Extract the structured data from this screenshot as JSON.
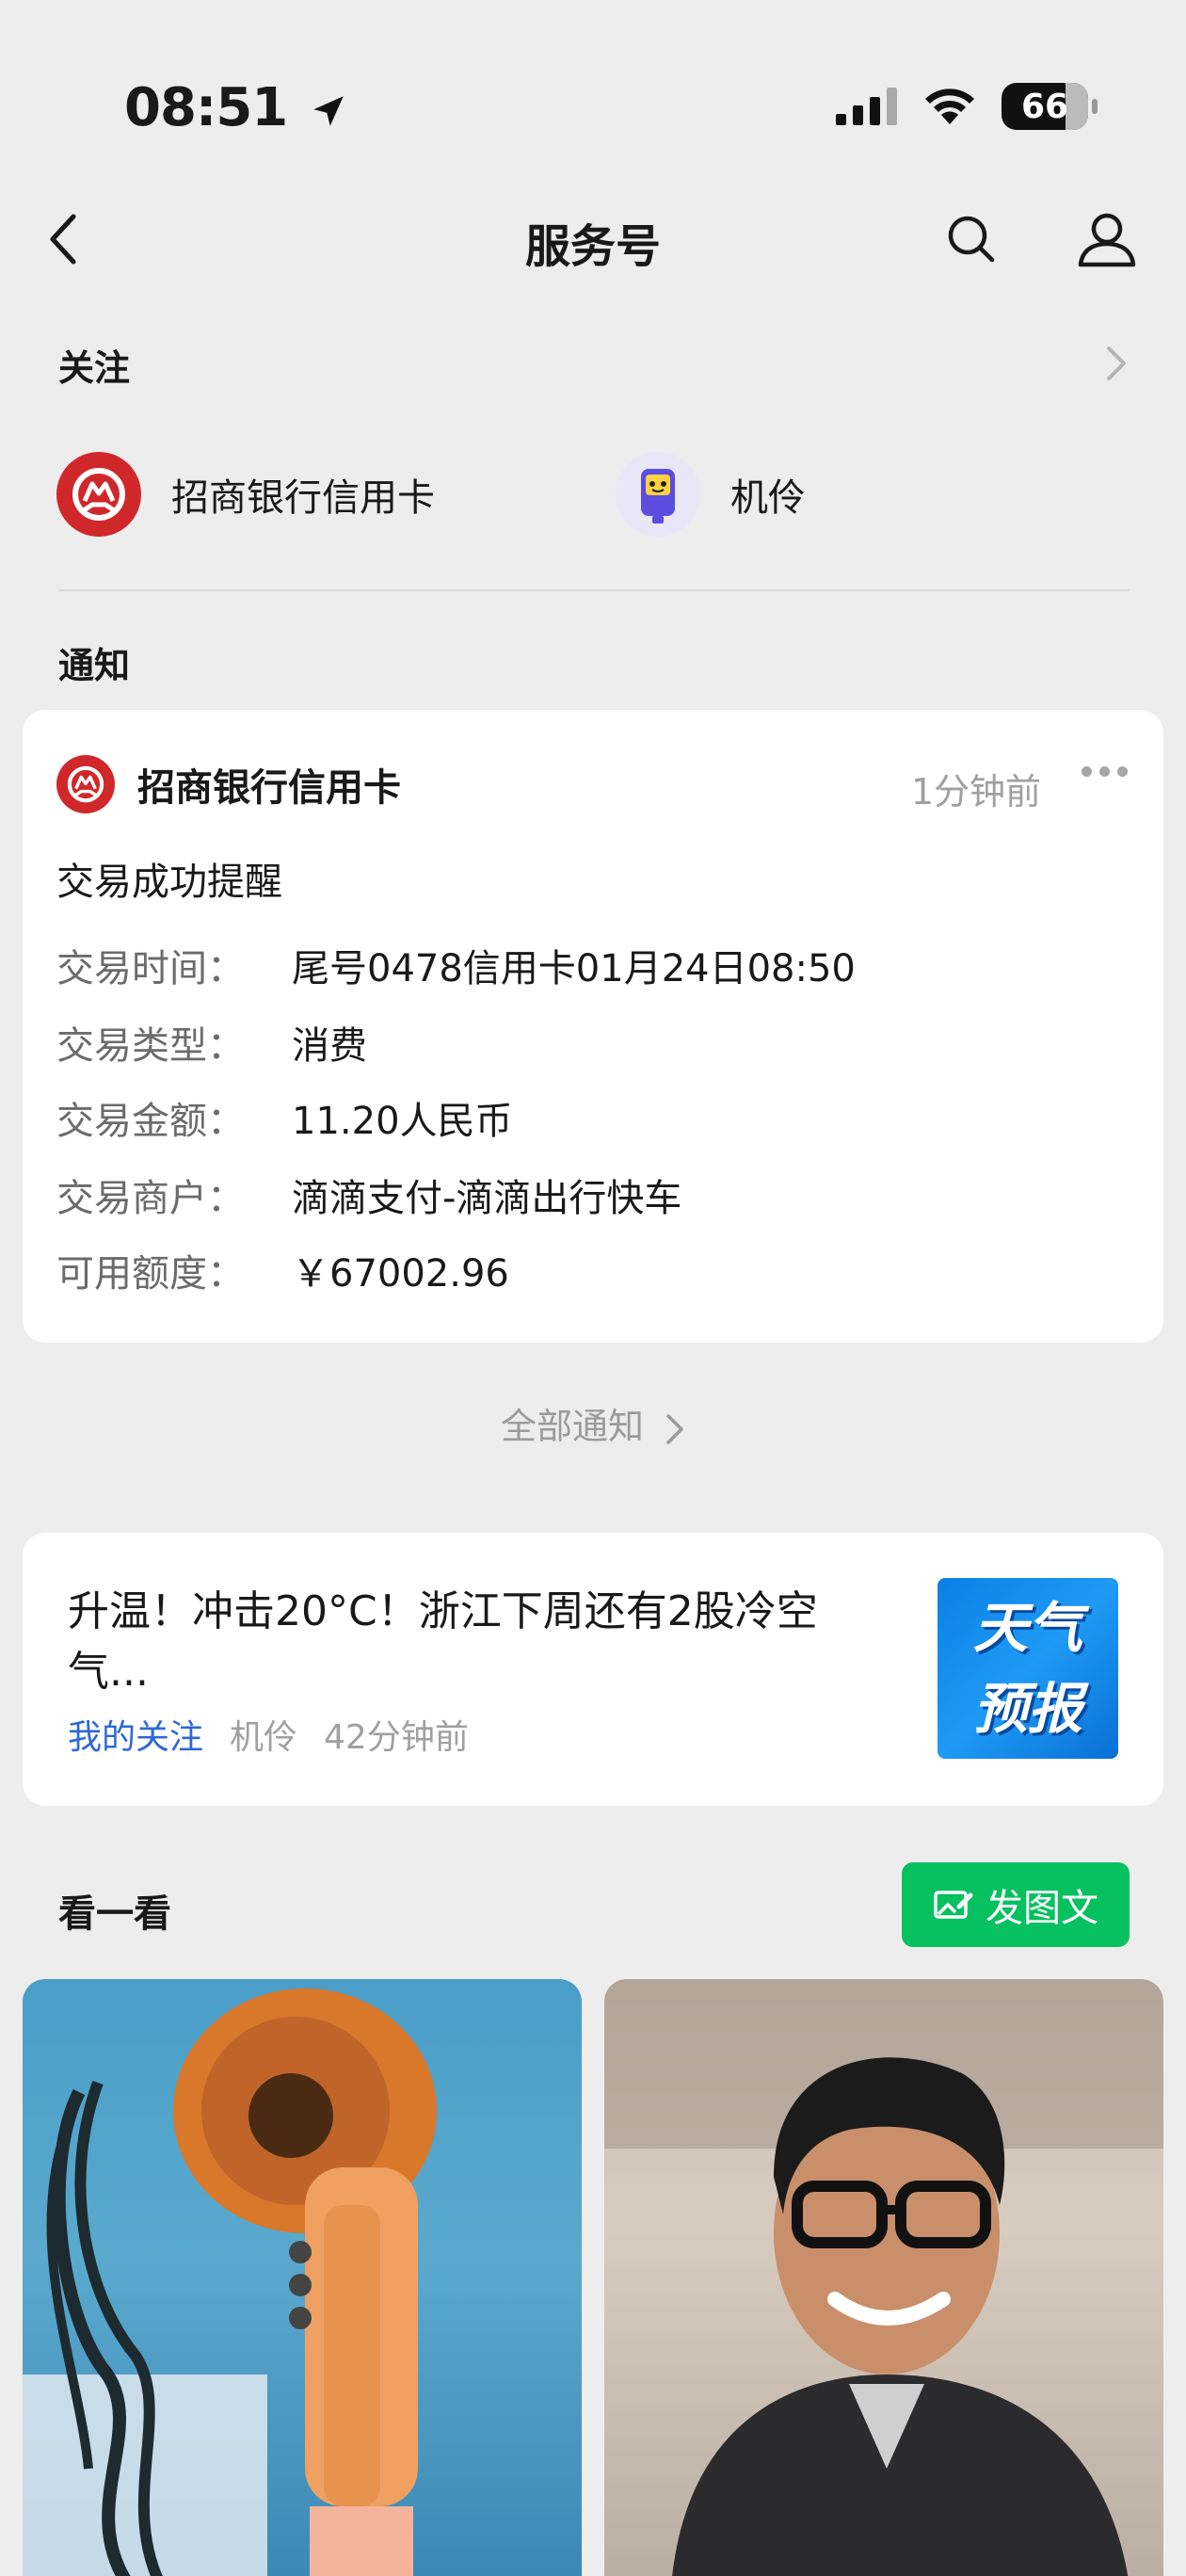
{
  "status_bar": {
    "time": "08:51",
    "battery": "66"
  },
  "nav": {
    "title": "服务号"
  },
  "follow_section": {
    "label": "关注",
    "items": [
      {
        "name": "招商银行信用卡",
        "icon": "cmb-logo-icon"
      },
      {
        "name": "机伶",
        "icon": "jiling-robot-icon"
      }
    ]
  },
  "notification_section": {
    "label": "通知",
    "card": {
      "source": "招商银行信用卡",
      "time": "1分钟前",
      "title": "交易成功提醒",
      "fields": [
        {
          "label": "交易时间：",
          "value": "尾号0478信用卡01月24日08:50"
        },
        {
          "label": "交易类型：",
          "value": "消费"
        },
        {
          "label": "交易金额：",
          "value": "11.20人民币"
        },
        {
          "label": "交易商户：",
          "value": "滴滴支付-滴滴出行快车"
        },
        {
          "label": "可用额度：",
          "value": "￥67002.96"
        }
      ]
    },
    "all_link": "全部通知"
  },
  "article": {
    "title": "升温！冲击20°C！浙江下周还有2股冷空气...",
    "tag": "我的关注",
    "source": "机伶",
    "time": "42分钟前",
    "thumb_line1": "天气",
    "thumb_line2": "预报"
  },
  "look_section": {
    "label": "看一看",
    "post_button": "发图文"
  },
  "colors": {
    "accent_green": "#07c160",
    "link_blue": "#2f68d6",
    "cmb_red": "#d0282a"
  }
}
